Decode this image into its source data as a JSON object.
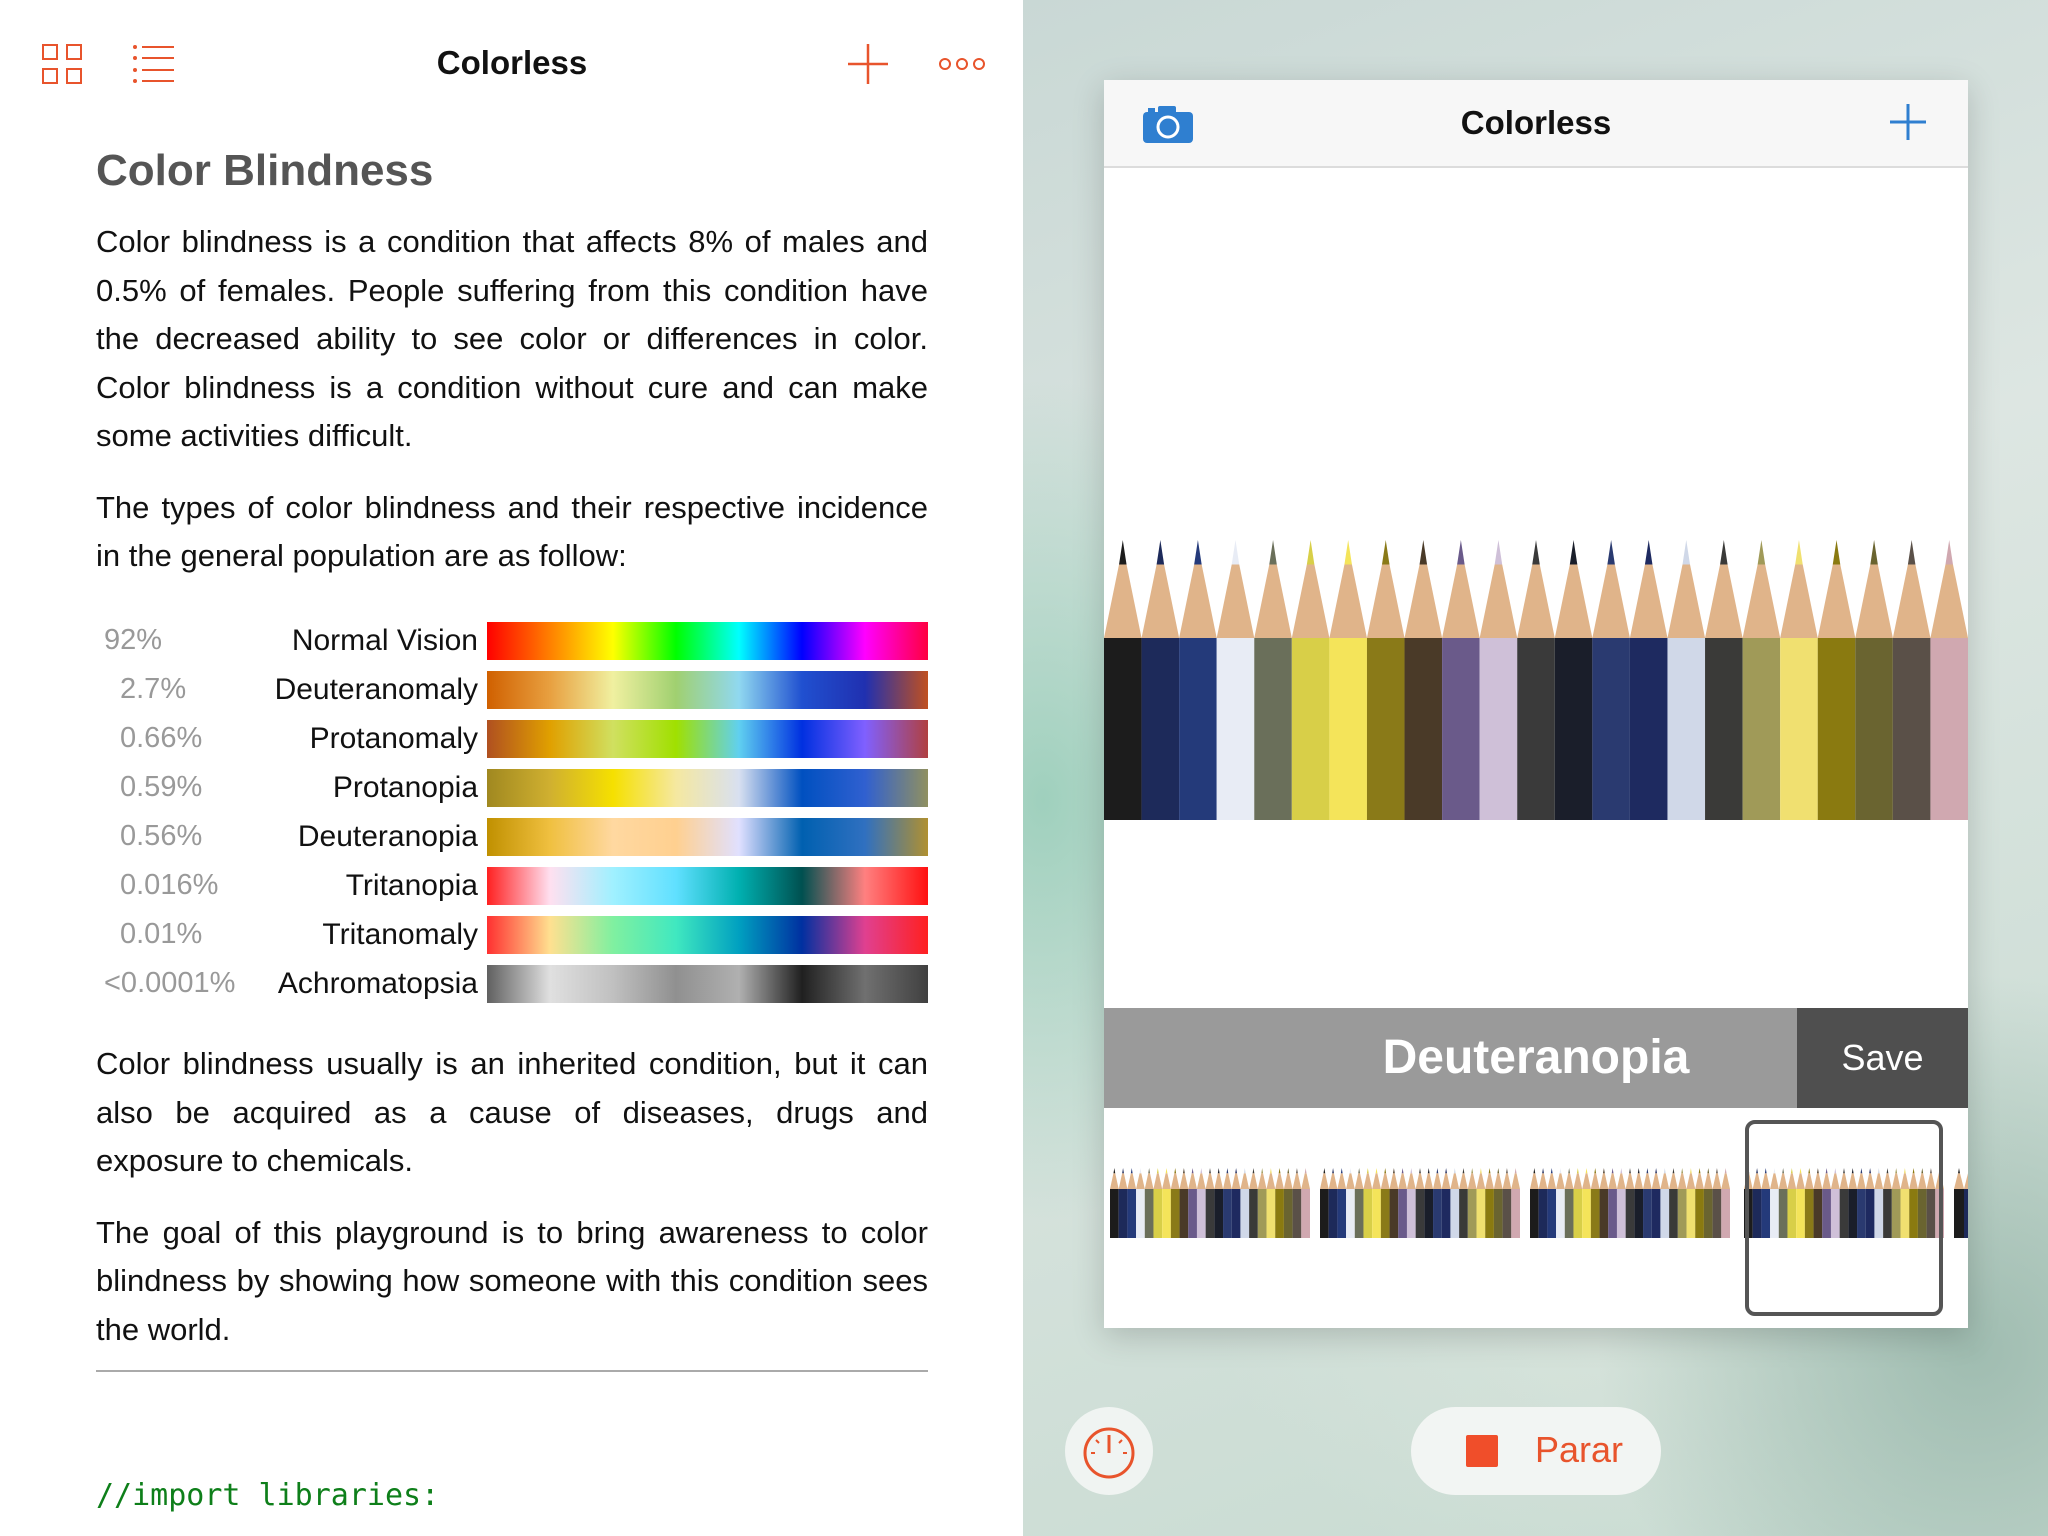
{
  "left": {
    "nav_title": "Colorless",
    "heading": "Color Blindness",
    "p1": "Color blindness is a condition that affects 8% of males and 0.5% of females. People suffering from this condition have the decreased ability to see color or differences in color. Color blindness is a condition without cure and can make some activities difficult.",
    "p2": "The types of color blindness and their respective incidence in the general population are as follow:",
    "types": [
      {
        "pct": "92%",
        "name": "Normal Vision",
        "colors": [
          "#ff0000",
          "#ff8000",
          "#ffff00",
          "#00ff00",
          "#00ffff",
          "#0000ff",
          "#ff00ff",
          "#ff0040"
        ]
      },
      {
        "pct": "2.7%",
        "name": "Deuteranomaly",
        "colors": [
          "#d06000",
          "#e8a040",
          "#f0f0a0",
          "#a0d070",
          "#90d8f0",
          "#2050d0",
          "#2030b0",
          "#c05020"
        ]
      },
      {
        "pct": "0.66%",
        "name": "Protanomaly",
        "colors": [
          "#b05020",
          "#e0a000",
          "#d0e060",
          "#a0e000",
          "#60d0f0",
          "#0030e0",
          "#8060ff",
          "#b04040"
        ]
      },
      {
        "pct": "0.59%",
        "name": "Protanopia",
        "colors": [
          "#a08820",
          "#d0b030",
          "#f5e000",
          "#f5e8a0",
          "#d8e0f0",
          "#0050c0",
          "#3060d0",
          "#909060"
        ]
      },
      {
        "pct": "0.56%",
        "name": "Deuteranopia",
        "colors": [
          "#c09000",
          "#f0c040",
          "#ffd8a0",
          "#ffd090",
          "#e0e0ff",
          "#0060b0",
          "#3070c0",
          "#b09030"
        ]
      },
      {
        "pct": "0.016%",
        "name": "Tritanopia",
        "colors": [
          "#ff2020",
          "#ffe0f0",
          "#a0f0ff",
          "#60e0ff",
          "#00b0b0",
          "#005050",
          "#ff8080",
          "#ff1010"
        ]
      },
      {
        "pct": "0.01%",
        "name": "Tritanomaly",
        "colors": [
          "#ff3030",
          "#ffe090",
          "#80f0a0",
          "#40e8c0",
          "#00a0c0",
          "#0030a0",
          "#e04090",
          "#ff2020"
        ]
      },
      {
        "pct": "<0.0001%",
        "name": "Achromatopsia",
        "colors": [
          "#606060",
          "#e0e0e0",
          "#c0c0c0",
          "#909090",
          "#b0b0b0",
          "#202020",
          "#707070",
          "#404040"
        ]
      }
    ],
    "p3": "Color blindness usually is an inherited condition, but it can also be acquired as a cause of diseases, drugs and exposure to chemicals.",
    "p4": "The goal of this playground is to bring awareness to color blindness by showing how someone with this condition sees the world.",
    "code": "//import libraries:"
  },
  "app": {
    "title": "Colorless",
    "filter_name": "Deuteranopia",
    "save_label": "Save",
    "pencil_colors": [
      "#1c1c1c",
      "#1d2a5a",
      "#243a7a",
      "#e8ecf5",
      "#6a6f5a",
      "#d8cf48",
      "#f4e45a",
      "#8a7a18",
      "#4a3a28",
      "#6a5a8a",
      "#cfc0d8",
      "#3a3a3a",
      "#1a1e2a",
      "#2a3a70",
      "#1e2a60",
      "#d0d8e8",
      "#3a3a38",
      "#a09a58",
      "#f0e070",
      "#8a7a10",
      "#6a6430",
      "#5a5048",
      "#d0a8b0"
    ],
    "thumb_filters": [
      "Normal Vision",
      "Protanopia",
      "Tritanopia",
      "Deuteranopia"
    ]
  },
  "bottom": {
    "stop_label": "Parar"
  },
  "colors": {
    "accent": "#e8542c",
    "app_accent": "#2f7fd0",
    "code_green": "#0e7f1a"
  },
  "icons": [
    "grid-icon",
    "list-icon",
    "plus-icon",
    "more-icon",
    "camera-icon",
    "speedometer-icon",
    "stop-icon"
  ]
}
